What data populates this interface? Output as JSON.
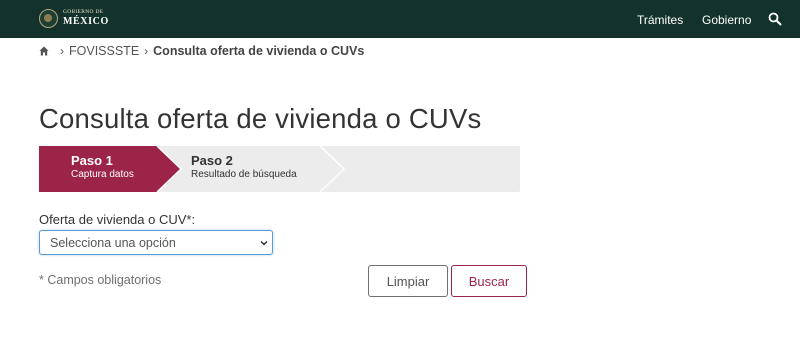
{
  "header": {
    "logo_line1": "GOBIERNO DE",
    "logo_line2": "MÉXICO",
    "nav": [
      {
        "label": "Trámites"
      },
      {
        "label": "Gobierno"
      }
    ],
    "search_icon": "search-icon",
    "bg_color": "#13322b"
  },
  "breadcrumb": {
    "home_icon": "home-icon",
    "items": [
      "FOVISSSTE",
      "Consulta oferta de vivienda o CUVs"
    ]
  },
  "page": {
    "title": "Consulta oferta de vivienda o CUVs"
  },
  "stepper": {
    "steps": [
      {
        "title": "Paso 1",
        "subtitle": "Captura datos",
        "active": true
      },
      {
        "title": "Paso 2",
        "subtitle": "Resultado de búsqueda",
        "active": false
      }
    ],
    "active_color": "#9d2449",
    "inactive_color": "#ececec"
  },
  "form": {
    "field_label": "Oferta de vivienda o CUV*:",
    "select_value": "Selecciona una opción",
    "required_note": "* Campos obligatorios",
    "clear_label": "Limpiar",
    "search_label": "Buscar"
  }
}
